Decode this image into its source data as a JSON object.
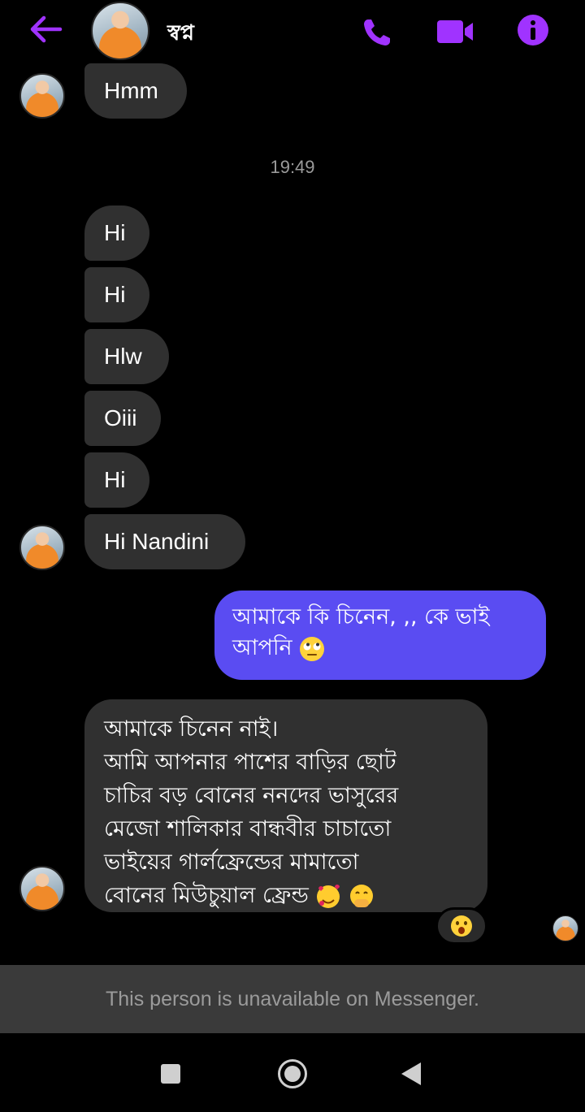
{
  "header": {
    "contact_name": "স্বপ্ন",
    "icons": [
      "back-arrow-icon",
      "phone-icon",
      "video-camera-icon",
      "info-icon"
    ],
    "accent_color": "#a033ff"
  },
  "messages": {
    "hmm": "Hmm",
    "timestamp": "19:49",
    "hi_1": "Hi",
    "hi_2": "Hi",
    "hlw": "Hlw",
    "oiii": "Oiii",
    "hi_3": "Hi",
    "hi_nandini": "Hi Nandini",
    "outgoing_text": "আমাকে কি চিনেন, ,, কে ভাই আপনি",
    "outgoing_emoji": "rolling-eyes-emoji",
    "long_line_1": "আমাকে চিনেন নাই।",
    "long_line_2": "আমি আপনার পাশের বাড়ির ছোট",
    "long_line_3": "চাচির বড় বোনের ননদের ভাসুরের",
    "long_line_4": "মেজো শালিকার বান্ধবীর চাচাতো",
    "long_line_5": "ভাইয়ের গার্লফ্রেন্ডের মামাতো",
    "long_line_6": "বোনের মিউচুয়াল ফ্রেন্ড",
    "long_emojis": [
      "smiling-face-with-hearts-emoji",
      "face-with-hand-over-mouth-emoji"
    ],
    "reaction": "astonished-face-emoji",
    "incoming_bubble_color": "#303030",
    "outgoing_bubble_color": "#5a4cf2"
  },
  "footer": {
    "unavailable_text": "This person is unavailable on Messenger."
  },
  "navbar": {
    "icons": [
      "recents-square-icon",
      "home-circle-icon",
      "back-triangle-icon"
    ]
  }
}
